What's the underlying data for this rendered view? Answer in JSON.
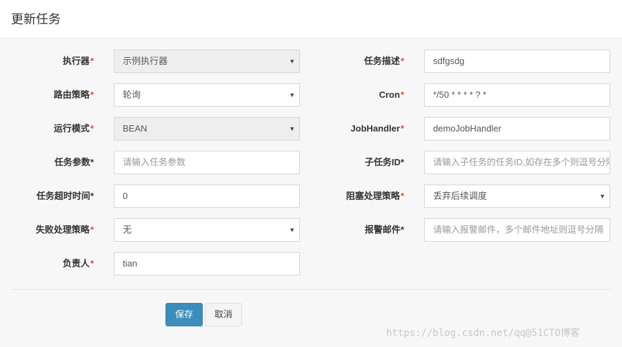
{
  "header": {
    "title": "更新任务"
  },
  "required_mark": "*",
  "form": {
    "executor": {
      "label": "执行器",
      "value": "示例执行器"
    },
    "route_strategy": {
      "label": "路由策略",
      "value": "轮询"
    },
    "run_mode": {
      "label": "运行模式",
      "value": "BEAN"
    },
    "task_params": {
      "label": "任务参数",
      "placeholder": "请输入任务参数"
    },
    "timeout": {
      "label": "任务超时时间",
      "value": "0"
    },
    "fail_strategy": {
      "label": "失败处理策略",
      "value": "无"
    },
    "owner": {
      "label": "负责人",
      "value": "tian"
    },
    "task_desc": {
      "label": "任务描述",
      "value": "sdfgsdg"
    },
    "cron": {
      "label": "Cron",
      "value": "*/50 * * * * ? *"
    },
    "job_handler": {
      "label": "JobHandler",
      "value": "demoJobHandler"
    },
    "child_task": {
      "label": "子任务ID",
      "placeholder": "请输入子任务的任务ID,如存在多个则逗号分隔"
    },
    "block_strategy": {
      "label": "阻塞处理策略",
      "value": "丢弃后续调度"
    },
    "alarm_email": {
      "label": "报警邮件",
      "placeholder": "请输入报警邮件，多个邮件地址则逗号分隔"
    }
  },
  "buttons": {
    "save": "保存",
    "cancel": "取消"
  },
  "watermark": "https://blog.csdn.net/qq@51CTO博客",
  "icons": {
    "select_caret": "caret-down-icon"
  },
  "colors": {
    "primary": "#3c8dbc",
    "required": "#dd4b39",
    "border": "#d2d6de",
    "disabled_bg": "#eeeeee"
  }
}
